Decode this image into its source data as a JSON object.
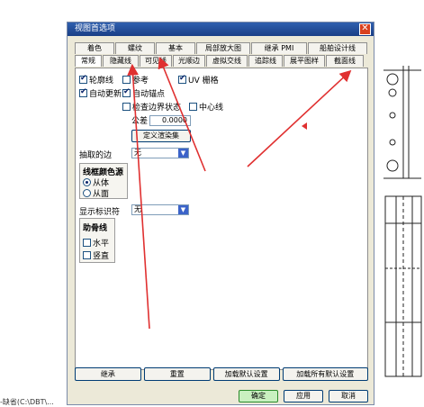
{
  "dialog": {
    "title": "视图首选项",
    "tabs_row1": [
      "着色",
      "螺纹",
      "基本",
      "局部放大图",
      "继承 PMI",
      "船舶设计线"
    ],
    "tabs_row2": [
      "常规",
      "隐藏线",
      "可见线",
      "光顺边",
      "虚拟交线",
      "追踪线",
      "展平图样",
      "截面线"
    ],
    "active_tab": "常规"
  },
  "general": {
    "silhouette_label": "轮廓线",
    "reference_label": "参考",
    "uv_grid_label": "UV 栅格",
    "auto_update_label": "自动更新",
    "auto_anchor_label": "自动锚点",
    "check_boundary_label": "检查边界状态",
    "centerline_label": "中心线",
    "tolerance_label": "公差",
    "tolerance_value": "0.0000",
    "define_render_set_label": "定义渲染集",
    "extract_edges_label": "抽取的边",
    "extract_edges_value": "无",
    "line_color_source_title": "线框颜色源",
    "from_body_label": "从体",
    "from_face_label": "从面",
    "show_identifier_label": "显示标识符",
    "show_identifier_value": "无",
    "aux_line_title": "助骨线",
    "horizontal_label": "水平",
    "vertical_label": "竖直"
  },
  "footer": {
    "inherit_label": "继承",
    "reset_label": "重置",
    "load_default_label": "加载默认设置",
    "load_all_default_label": "加载所有默认设置"
  },
  "buttons": {
    "ok_label": "确定",
    "apply_label": "应用",
    "cancel_label": "取消"
  },
  "background": {
    "bottom_note": "-缺省(C:\\DBT\\..."
  },
  "colors": {
    "title_bar": "#1a3f86",
    "arrow_red": "#e03030",
    "ok_button": "#c9f0c0"
  }
}
